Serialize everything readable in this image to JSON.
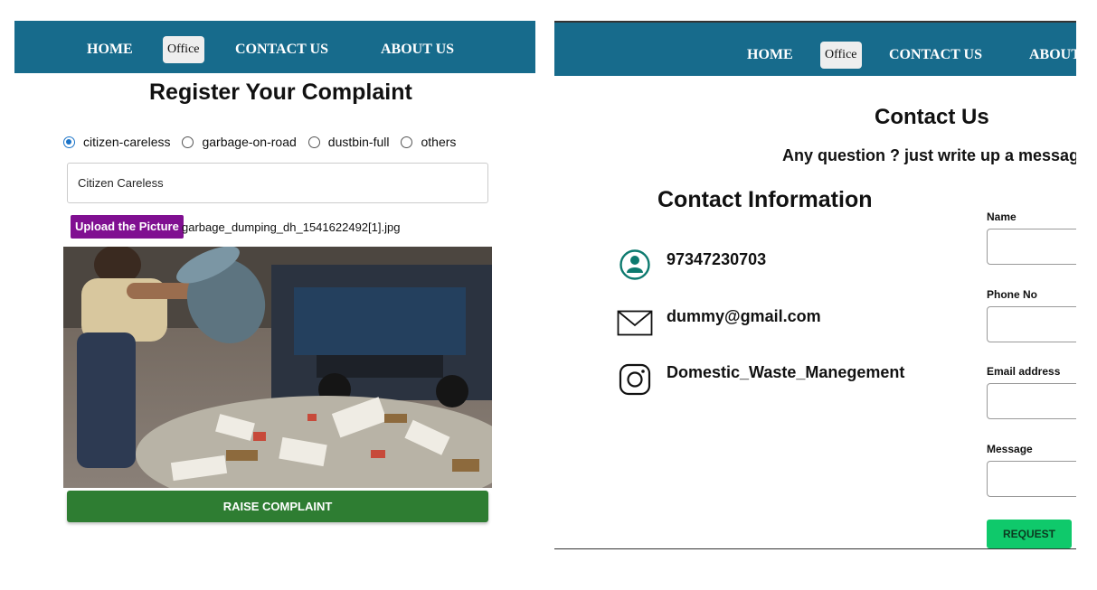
{
  "left_nav": {
    "home": "HOME",
    "office": "Office",
    "contact": "CONTACT US",
    "about": "ABOUT US"
  },
  "complaint": {
    "title": "Register Your Complaint",
    "options": [
      "citizen-careless",
      "garbage-on-road",
      "dustbin-full",
      "others"
    ],
    "selected": "citizen-careless",
    "input_value": "Citizen Careless",
    "upload_label": "Upload the Picture",
    "file_name": "garbage_dumping_dh_1541622492[1].jpg",
    "submit_label": "RAISE COMPLAINT"
  },
  "right_nav": {
    "home": "HOME",
    "office": "Office",
    "contact": "CONTACT US",
    "about": "ABOUT"
  },
  "contact": {
    "title": "Contact Us",
    "subtitle": "Any question ? just write up a message",
    "info_title": "Contact Information",
    "phone": "97347230703",
    "email": "dummy@gmail.com",
    "instagram": "Domestic_Waste_Manegement",
    "form": {
      "name_label": "Name",
      "phone_label": "Phone No",
      "email_label": "Email address",
      "message_label": "Message",
      "submit_label": "REQUEST"
    }
  },
  "colors": {
    "nav_bg": "#176b8c",
    "upload_btn": "#800f91",
    "raise_btn": "#2e7d32",
    "request_btn": "#0fc96b",
    "icon_teal": "#0d7a6f"
  },
  "icons": [
    "person-circle-icon",
    "mail-icon",
    "instagram-icon"
  ]
}
